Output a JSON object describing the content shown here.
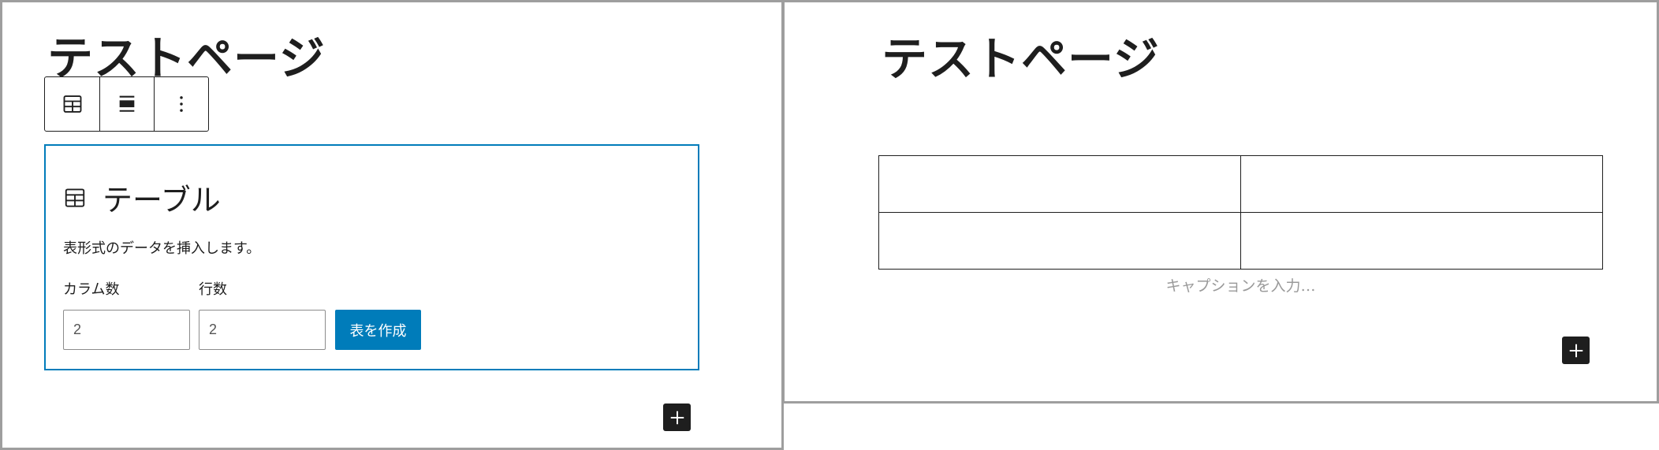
{
  "left": {
    "page_title": "テストページ",
    "toolbar": {
      "table_icon": "table-icon",
      "align_icon": "align-center-icon",
      "more_icon": "more-vertical-icon"
    },
    "placeholder": {
      "icon": "table-icon",
      "title": "テーブル",
      "description": "表形式のデータを挿入します。",
      "columns_label": "カラム数",
      "rows_label": "行数",
      "columns_value": "2",
      "rows_value": "2",
      "create_button": "表を作成"
    },
    "add_block_icon": "plus-icon"
  },
  "right": {
    "page_title": "テストページ",
    "table": {
      "rows": [
        [
          "",
          ""
        ],
        [
          "",
          ""
        ]
      ]
    },
    "caption_placeholder": "キャプションを入力…",
    "add_block_icon": "plus-icon"
  },
  "colors": {
    "accent": "#007cba",
    "text": "#1e1e1e",
    "panel_border": "#9e9e9e",
    "caption": "#9a9a9a"
  }
}
